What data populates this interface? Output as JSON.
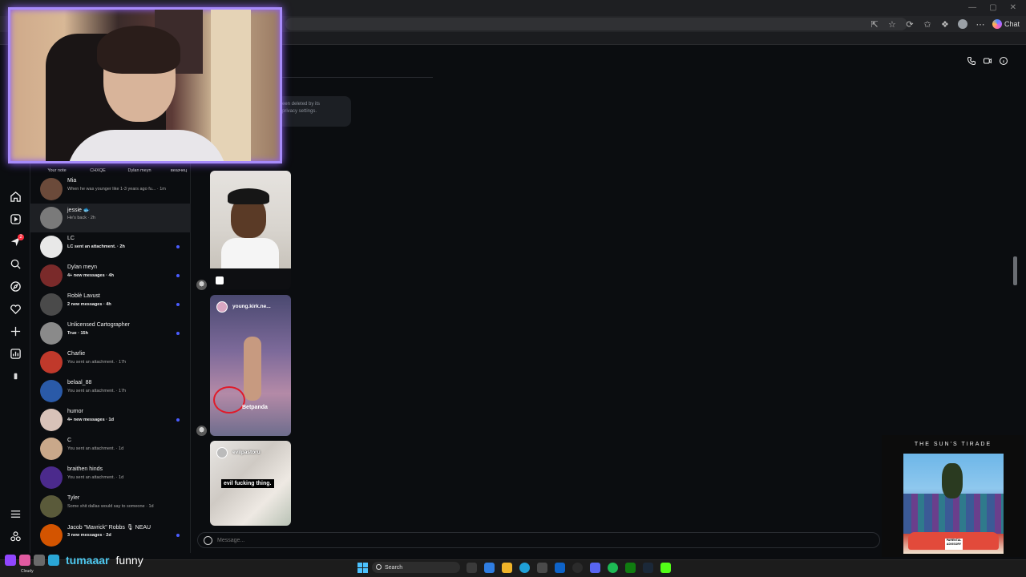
{
  "browser": {
    "chat_label": "Chat"
  },
  "notes": [
    "Your note",
    "CHXQE",
    "Dylan meyn",
    "веазчец"
  ],
  "conversations": [
    {
      "name": "Mia",
      "preview": "When he was younger like 1-3 years ago fu... · 1m",
      "unread": false,
      "active": false,
      "avatar_color": "#6b4a3a"
    },
    {
      "name": "jessie 🐟",
      "preview": "He's back · 2h",
      "unread": false,
      "active": true,
      "avatar_color": "#7a7a7a"
    },
    {
      "name": "LC",
      "preview": "LC sent an attachment. · 2h",
      "unread": true,
      "active": false,
      "avatar_color": "#e8e8e8"
    },
    {
      "name": "Dylan meyn",
      "preview": "4+ new messages · 4h",
      "unread": true,
      "active": false,
      "avatar_color": "#7a2a2a"
    },
    {
      "name": "Roblè Lavust",
      "preview": "2 new messages · 4h",
      "unread": true,
      "active": false,
      "avatar_color": "#4a4a4a"
    },
    {
      "name": "Unlicensed Cartographer",
      "preview": "True · 15h",
      "unread": true,
      "active": false,
      "avatar_color": "#8a8a8a"
    },
    {
      "name": "Charlie",
      "preview": "You sent an attachment. · 17h",
      "unread": false,
      "active": false,
      "avatar_color": "#c0392b"
    },
    {
      "name": "belaal_88",
      "preview": "You sent an attachment. · 17h",
      "unread": false,
      "active": false,
      "avatar_color": "#2a5aa8"
    },
    {
      "name": "humor",
      "preview": "4+ new messages · 1d",
      "unread": true,
      "active": false,
      "avatar_color": "#d8c2b8"
    },
    {
      "name": "C",
      "preview": "You sent an attachment. · 1d",
      "unread": false,
      "active": false,
      "avatar_color": "#c9a88a"
    },
    {
      "name": "braithen hinds",
      "preview": "You sent an attachment. · 1d",
      "unread": false,
      "active": false,
      "avatar_color": "#4b2a8c"
    },
    {
      "name": "Tyler",
      "preview": "Some shit dallas would say to someone · 1d",
      "unread": false,
      "active": false,
      "avatar_color": "#5a5a3a"
    },
    {
      "name": "Jacob \"Mavrick\" Robbs 🎙 NEAU",
      "preview": "3 new messages · 2d",
      "unread": true,
      "active": false,
      "avatar_color": "#d35400"
    }
  ],
  "thread": {
    "deleted_notice_line1": "een deleted by its",
    "deleted_notice_line2": "privacy settings.",
    "media": [
      {
        "handle": "",
        "caption": ""
      },
      {
        "handle": "young.kirk.ne...",
        "caption": "Betpanda"
      },
      {
        "handle": "evilpastoru",
        "caption": "evil fucking thing."
      }
    ],
    "composer_placeholder": "Message..."
  },
  "now_playing": {
    "title": "THE SUN'S TIRADE",
    "advisory": "PARENTAL ADVISORY"
  },
  "stream_chat": {
    "username": "tumaaar",
    "message": "funny"
  },
  "weather": "Cloudy",
  "taskbar": {
    "search_label": "Search"
  },
  "colors": {
    "accent_unread": "#4a5cff",
    "webcam_border": "#a78bfa",
    "notification": "#ff3040",
    "chat_username": "#4ec9f0"
  },
  "notification_count": "2"
}
